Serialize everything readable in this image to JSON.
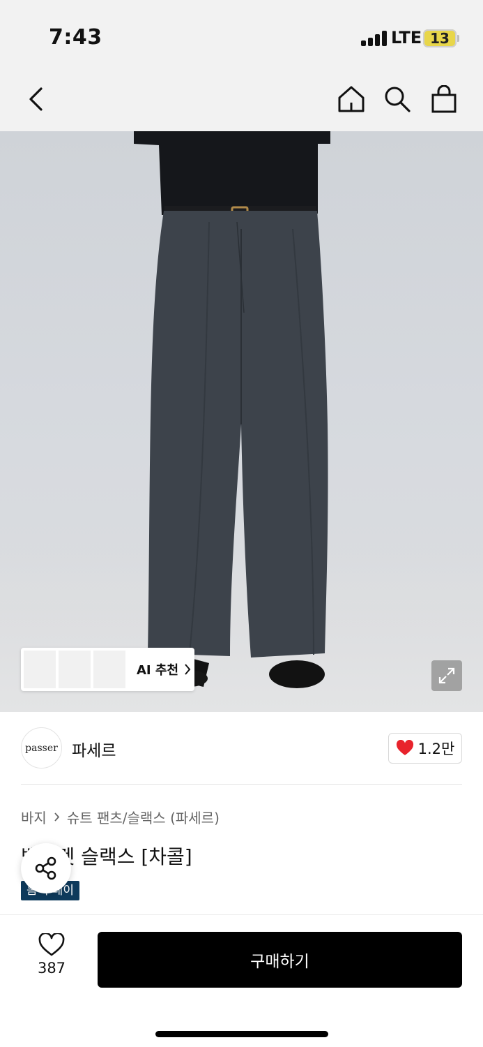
{
  "status_bar": {
    "time": "7:43",
    "carrier": "LTE",
    "battery": "13"
  },
  "nav": {
    "icons": [
      "back-icon",
      "home-icon",
      "search-icon",
      "bag-icon"
    ]
  },
  "hero": {
    "ai_recommend_label": "AI 추천",
    "ai_thumb_count": 3
  },
  "brand": {
    "logo_text": "passer",
    "name": "파세르",
    "likes": "1.2만"
  },
  "breadcrumb": {
    "category": "바지",
    "subcategory": "슈트 팬츠/슬랙스 (파세르)"
  },
  "product": {
    "title": "백포켓 슬랙스 [차콜]",
    "badge": "봄 투데이"
  },
  "bottom_bar": {
    "wish_count": "387",
    "buy_label": "구매하기"
  },
  "colors": {
    "accent": "#000000",
    "badge": "#0e3a5c",
    "heart": "#e8232c"
  }
}
